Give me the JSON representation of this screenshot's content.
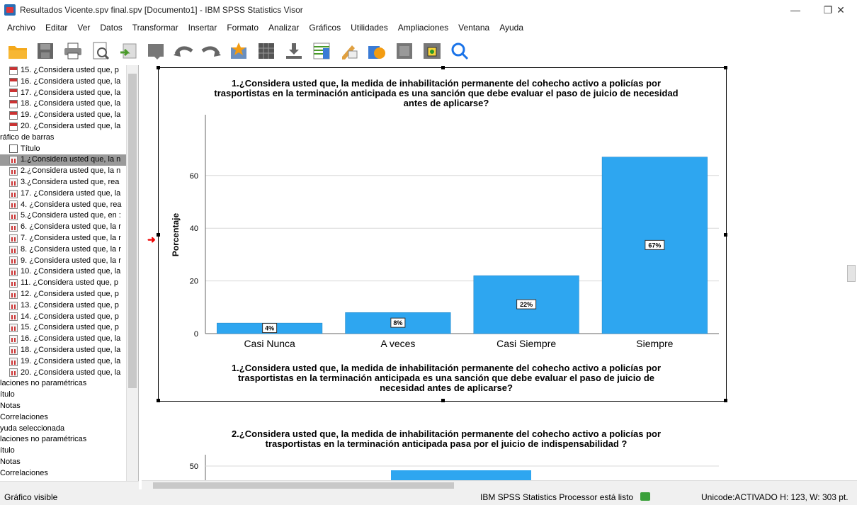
{
  "window": {
    "title": "Resultados Vicente.spv final.spv [Documento1] - IBM SPSS Statistics Visor",
    "controls": {
      "minimize": "—",
      "restore": "❐",
      "close": "✕"
    }
  },
  "menu": [
    "Archivo",
    "Editar",
    "Ver",
    "Datos",
    "Transformar",
    "Insertar",
    "Formato",
    "Analizar",
    "Gráficos",
    "Utilidades",
    "Ampliaciones",
    "Ventana",
    "Ayuda"
  ],
  "toolbar": [
    "open-folder-icon",
    "save-icon",
    "print-icon",
    "print-preview-icon",
    "export-icon",
    "recall-dialog-icon",
    "undo-icon",
    "redo-icon",
    "goto-data-icon",
    "goto-case-icon",
    "goto-variable-icon",
    "variables-icon",
    "designate-window-icon",
    "run-script-icon",
    "hide-icon",
    "show-icon",
    "search-icon"
  ],
  "nav": {
    "items": [
      {
        "icon": "table",
        "label": "15. ¿Considera usted que, p"
      },
      {
        "icon": "table",
        "label": "16. ¿Considera usted que, la"
      },
      {
        "icon": "table",
        "label": "17. ¿Considera usted que, la"
      },
      {
        "icon": "table",
        "label": "18. ¿Considera usted que, la"
      },
      {
        "icon": "table",
        "label": "19. ¿Considera usted que, la"
      },
      {
        "icon": "table",
        "label": "20. ¿Considera usted que, la"
      },
      {
        "icon": "none",
        "label": "ráfico de barras"
      },
      {
        "icon": "title",
        "label": "Título"
      },
      {
        "icon": "chart",
        "label": "1.¿Considera usted que, la n"
      },
      {
        "icon": "chart",
        "label": "2.¿Considera usted que, la n"
      },
      {
        "icon": "chart",
        "label": "3.¿Considera usted que, rea"
      },
      {
        "icon": "chart",
        "label": "17. ¿Considera usted que, la"
      },
      {
        "icon": "chart",
        "label": "4. ¿Considera usted que, rea"
      },
      {
        "icon": "chart",
        "label": "5.¿Considera usted que, en :"
      },
      {
        "icon": "chart",
        "label": "6. ¿Considera usted que, la r"
      },
      {
        "icon": "chart",
        "label": "7. ¿Considera usted que, la r"
      },
      {
        "icon": "chart",
        "label": "8. ¿Considera usted que, la r"
      },
      {
        "icon": "chart",
        "label": "9. ¿Considera usted que, la r"
      },
      {
        "icon": "chart",
        "label": "10. ¿Considera usted que, la"
      },
      {
        "icon": "chart",
        "label": "11. ¿Considera usted que, p"
      },
      {
        "icon": "chart",
        "label": "12. ¿Considera usted que, p"
      },
      {
        "icon": "chart",
        "label": "13. ¿Considera usted que, p"
      },
      {
        "icon": "chart",
        "label": "14. ¿Considera usted que, p"
      },
      {
        "icon": "chart",
        "label": "15. ¿Considera usted que, p"
      },
      {
        "icon": "chart",
        "label": "16. ¿Considera usted que, la"
      },
      {
        "icon": "chart",
        "label": "18. ¿Considera usted que, la"
      },
      {
        "icon": "chart",
        "label": "19. ¿Considera usted que, la"
      },
      {
        "icon": "chart",
        "label": "20. ¿Considera usted que, la"
      },
      {
        "icon": "none",
        "label": "laciones no paramétricas"
      },
      {
        "icon": "none",
        "label": "ítulo"
      },
      {
        "icon": "none",
        "label": "Notas"
      },
      {
        "icon": "none",
        "label": "Correlaciones"
      },
      {
        "icon": "none",
        "label": "yuda seleccionada"
      },
      {
        "icon": "none",
        "label": "laciones no paramétricas"
      },
      {
        "icon": "none",
        "label": "ítulo"
      },
      {
        "icon": "none",
        "label": "Notas"
      },
      {
        "icon": "none",
        "label": "Correlaciones"
      }
    ],
    "selected_index": 8
  },
  "chart_data": [
    {
      "type": "bar",
      "title": "1.¿Considera usted que, la medida de inhabilitación permanente del cohecho activo a policías por trasportistas en la terminación anticipada es una sanción que debe evaluar el paso de juicio de necesidad antes de aplicarse?",
      "title_lines": [
        "1.¿Considera usted que, la medida de inhabilitación permanente del cohecho activo a policías por",
        "trasportistas en la terminación anticipada es una sanción que debe evaluar el paso de juicio de necesidad",
        "antes de aplicarse?"
      ],
      "xlabel_lines": [
        "1.¿Considera usted que, la medida de inhabilitación permanente del cohecho activo a policías por",
        "trasportistas en la terminación anticipada es una sanción que debe evaluar el paso de juicio de",
        "necesidad antes de aplicarse?"
      ],
      "ylabel": "Porcentaje",
      "categories": [
        "Casi Nunca",
        "A veces",
        "Casi Siempre",
        "Siempre"
      ],
      "values": [
        4,
        8,
        22,
        67
      ],
      "data_labels": [
        "4%",
        "8%",
        "22%",
        "67%"
      ],
      "yticks": [
        0,
        20,
        40,
        60
      ],
      "ylim": [
        0,
        75
      ],
      "bar_color": "#2EA6F0",
      "grid": true
    },
    {
      "type": "bar",
      "title_lines": [
        "2.¿Considera usted que, la medida de inhabilitación permanente del cohecho activo a policías por",
        "trasportistas en la terminación anticipada pasa por el juicio de indispensabilidad ?"
      ],
      "yticks": [
        50
      ],
      "bar_color": "#2EA6F0"
    }
  ],
  "status": {
    "left": "Gráfico visible",
    "processor": "IBM SPSS Statistics Processor está listo",
    "right": "Unicode:ACTIVADO  H: 123, W: 303 pt."
  }
}
